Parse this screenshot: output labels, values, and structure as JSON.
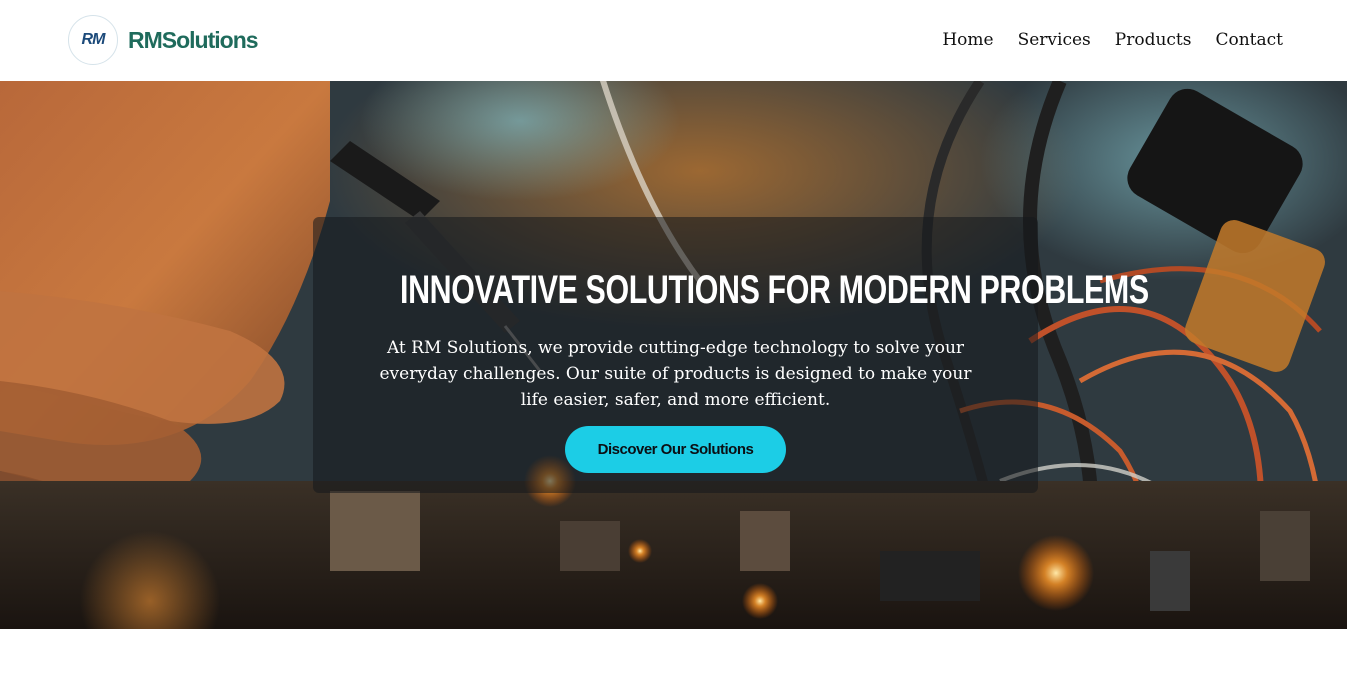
{
  "brand": {
    "badge": "RM",
    "name": "RMSolutions",
    "name_color": "#1f6b5c"
  },
  "nav": {
    "items": [
      {
        "label": "Home"
      },
      {
        "label": "Services"
      },
      {
        "label": "Products"
      },
      {
        "label": "Contact"
      }
    ]
  },
  "hero": {
    "title": "INNOVATIVE SOLUTIONS FOR MODERN PROBLEMS",
    "description": "At RM Solutions, we provide cutting-edge technology to solve your everyday challenges. Our suite of products is designed to make your life easier, safer, and more efficient.",
    "cta_label": "Discover Our Solutions",
    "cta_color": "#1ccde6",
    "background": "electronics-soldering-photo"
  }
}
